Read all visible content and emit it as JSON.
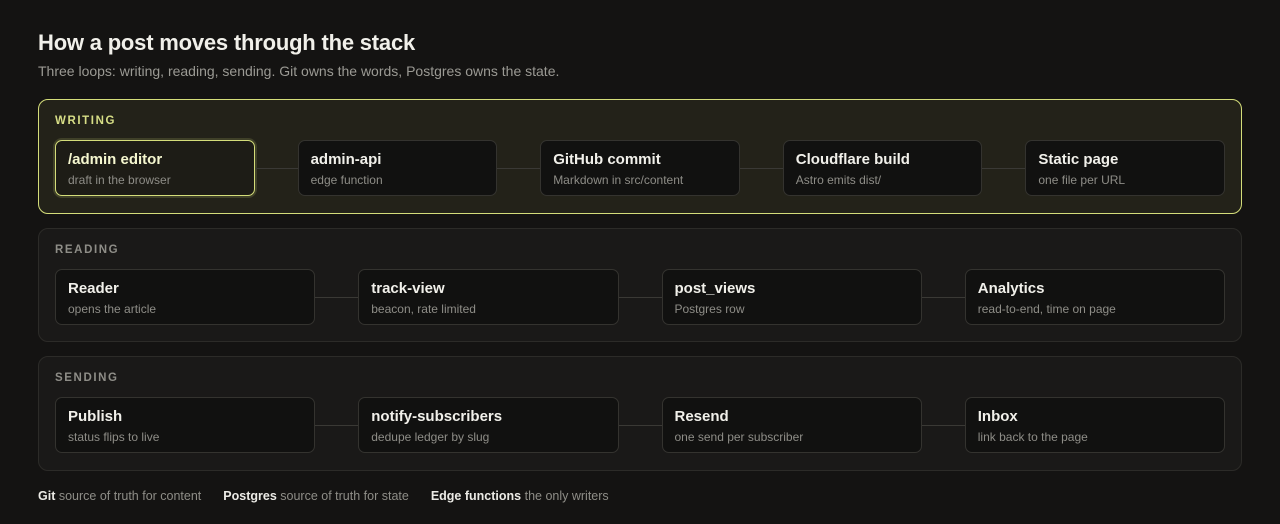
{
  "header": {
    "title": "How a post moves through the stack",
    "subtitle": "Three loops: writing, reading, sending. Git owns the words, Postgres owns the state."
  },
  "colors": {
    "accent": "#d4dd7a",
    "background": "#141312",
    "panel": "#1a1918",
    "node": "#111110"
  },
  "sections": [
    {
      "label": "WRITING",
      "nodes": [
        {
          "title": "/admin editor",
          "sub": "draft in the browser"
        },
        {
          "title": "admin-api",
          "sub": "edge function"
        },
        {
          "title": "GitHub commit",
          "sub": "Markdown in src/content"
        },
        {
          "title": "Cloudflare build",
          "sub": "Astro emits dist/"
        },
        {
          "title": "Static page",
          "sub": "one file per URL"
        }
      ]
    },
    {
      "label": "READING",
      "nodes": [
        {
          "title": "Reader",
          "sub": "opens the article"
        },
        {
          "title": "track-view",
          "sub": "beacon, rate limited"
        },
        {
          "title": "post_views",
          "sub": "Postgres row"
        },
        {
          "title": "Analytics",
          "sub": "read-to-end, time on page"
        }
      ]
    },
    {
      "label": "SENDING",
      "nodes": [
        {
          "title": "Publish",
          "sub": "status flips to live"
        },
        {
          "title": "notify-subscribers",
          "sub": "dedupe ledger by slug"
        },
        {
          "title": "Resend",
          "sub": "one send per subscriber"
        },
        {
          "title": "Inbox",
          "sub": "link back to the page"
        }
      ]
    }
  ],
  "legend": [
    {
      "term": "Git",
      "desc": "source of truth for content"
    },
    {
      "term": "Postgres",
      "desc": "source of truth for state"
    },
    {
      "term": "Edge functions",
      "desc": "the only writers"
    }
  ]
}
